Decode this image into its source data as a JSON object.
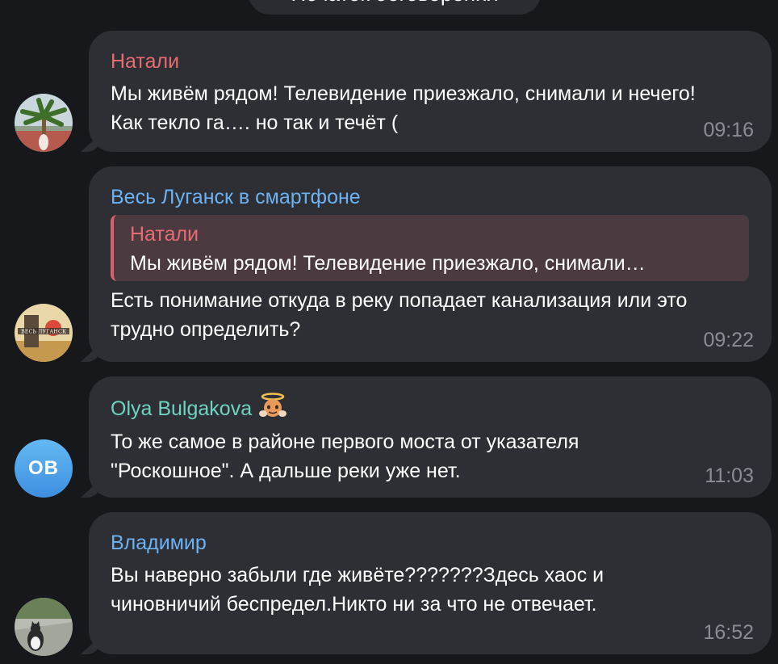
{
  "service_message": "Початок обговорення",
  "messages": [
    {
      "sender": "Натали",
      "sender_color": "#e86b72",
      "text": "Мы живём рядом!  Телевидение приезжало, снимали и нечего! Как текло га…. но так и течёт (",
      "time": "09:16",
      "avatar": "palm-tree-photo"
    },
    {
      "sender": "Весь Луганск в смартфоне",
      "sender_color": "#6cb2f2",
      "reply": {
        "name": "Натали",
        "text": "Мы живём рядом!  Телевидение приезжало, снимали…"
      },
      "text": "Есть понимание откуда в реку попадает канализация или это трудно определить?",
      "time": "09:22",
      "avatar": "lugansk-sign-photo"
    },
    {
      "sender": "Olya Bulgakova",
      "sender_color": "#6ed3c0",
      "sender_emoji": "angel-face",
      "text": "То же самое в районе первого моста от указателя \"Роскошное\". А дальше реки уже нет.",
      "time": "11:03",
      "avatar_initials": "OB"
    },
    {
      "sender": "Владимир",
      "sender_color": "#6cb2f2",
      "text": "Вы наверно забыли где живёте???????Здесь хаос и чиновничий беспредел.Никто ни за что не отвечает.",
      "time": "16:52",
      "avatar": "cat-photo"
    }
  ]
}
